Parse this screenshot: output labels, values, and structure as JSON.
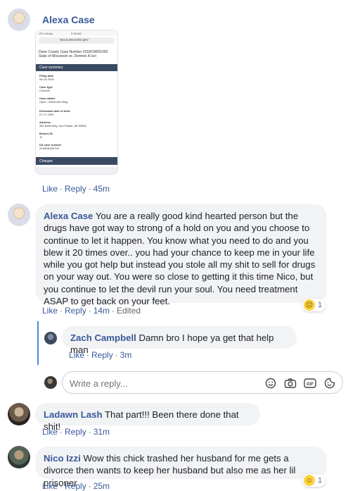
{
  "comments": {
    "first": {
      "author": "Alexa Case",
      "attachment": {
        "carrier": "US Cellular",
        "clock": "9:38 AM",
        "url": "wcca.wicourts.gov",
        "case_title": "Dane County Case Number 2018CM001050 State of Wisconsin vs. Dominic A Izzi",
        "section_summary": "Case summary",
        "fields": [
          {
            "label": "Filing date",
            "value": "06-19-2018"
          },
          {
            "label": "Case type",
            "value": "Criminal"
          },
          {
            "label": "Case status",
            "value": "Open - Electronic filing"
          },
          {
            "label": "Defendant date of birth",
            "value": "07-17-1990"
          },
          {
            "label": "Address",
            "value": "351 Bella Way, Sun Prairie, WI 53590"
          },
          {
            "label": "Branch ID",
            "value": "11"
          },
          {
            "label": "DA case number",
            "value": "2018DA005726"
          }
        ],
        "section_charges": "Charges"
      },
      "like": "Like",
      "reply": "Reply",
      "time": "45m"
    },
    "second": {
      "author": "Alexa Case",
      "text": "You are a really good kind hearted person but the drugs have got way to strong of a hold on you and you choose to continue to let it happen. You know what you need to do and you blew it 20 times over.. you had your chance to keep me in your life while you got help but instead you stole all my shit to sell for drugs on your way out. You were so close to getting it this time Nico, but you continue to let the devil run your soul. You need treatment ASAP to get back on your feet.",
      "like": "Like",
      "reply": "Reply",
      "time": "14m",
      "edited": "Edited",
      "reaction_count": "1",
      "reply_item": {
        "author": "Zach Campbell",
        "text": "Damn bro I hope ya get that help man",
        "like": "Like",
        "reply": "Reply",
        "time": "3m"
      }
    },
    "reply_input": {
      "placeholder": "Write a reply..."
    },
    "third": {
      "author": "Ladawn Lash",
      "text": "That part!!! Been there done that shit!",
      "like": "Like",
      "reply": "Reply",
      "time": "31m"
    },
    "fourth": {
      "author": "Nico Izzi",
      "text": "Wow this chick trashed her husband for me gets a divorce then wants to keep her husband but also me as her lil prisoner",
      "like": "Like",
      "reply": "Reply",
      "time": "25m",
      "reaction_count": "1"
    }
  },
  "icons": {
    "sad_reaction": "sad-face-icon",
    "haha_reaction": "laugh-face-icon",
    "emoji": "smiley-icon",
    "camera": "camera-icon",
    "gif": "gif-icon",
    "sticker": "sticker-icon"
  },
  "colors": {
    "link": "#385898",
    "bubble": "#f2f3f5",
    "thread_line": "#4b89dc"
  }
}
